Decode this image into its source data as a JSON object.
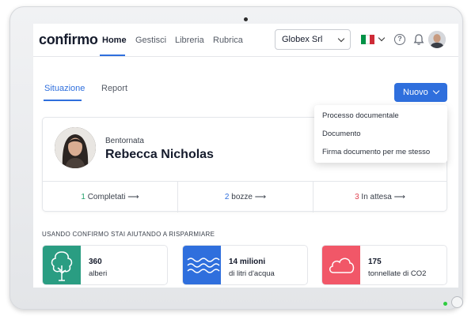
{
  "app": {
    "logo": "confirmo"
  },
  "nav": {
    "items": [
      "Home",
      "Gestisci",
      "Libreria",
      "Rubrica"
    ],
    "active": "Home"
  },
  "company_select": {
    "value": "Globex Srl"
  },
  "language": {
    "flag": "italy-flag",
    "colors": [
      "#009246",
      "#ffffff",
      "#ce2b37"
    ]
  },
  "icons": {
    "help": "help-icon",
    "notifications": "bell-icon",
    "profile": "avatar"
  },
  "subtabs": {
    "items": [
      "Situazione",
      "Report"
    ],
    "active": "Situazione"
  },
  "new_button": {
    "label": "Nuovo"
  },
  "new_menu": {
    "items": [
      "Processo documentale",
      "Documento",
      "Firma documento per me stesso"
    ]
  },
  "welcome": {
    "greeting": "Bentornata",
    "name": "Rebecca Nicholas"
  },
  "stats": [
    {
      "count": "1",
      "label": "Completati",
      "color": "#22a06b"
    },
    {
      "count": "2",
      "label": "bozze",
      "color": "#2f6fdd"
    },
    {
      "count": "3",
      "label": "In attesa",
      "color": "#e04452"
    }
  ],
  "savings": {
    "title": "USANDO CONFIRMO STAI AIUTANDO A RISPARMIARE",
    "items": [
      {
        "value": "360",
        "unit": "alberi",
        "icon": "tree-icon",
        "color": "#2a9d82"
      },
      {
        "value": "14 milioni",
        "unit": "di litri d'acqua",
        "icon": "water-icon",
        "color": "#2f6fdd"
      },
      {
        "value": "175",
        "unit": "tonnellate di CO2",
        "icon": "cloud-icon",
        "color": "#f15768"
      }
    ]
  },
  "colors": {
    "accent": "#2f6fdd",
    "text": "#151b2c"
  }
}
